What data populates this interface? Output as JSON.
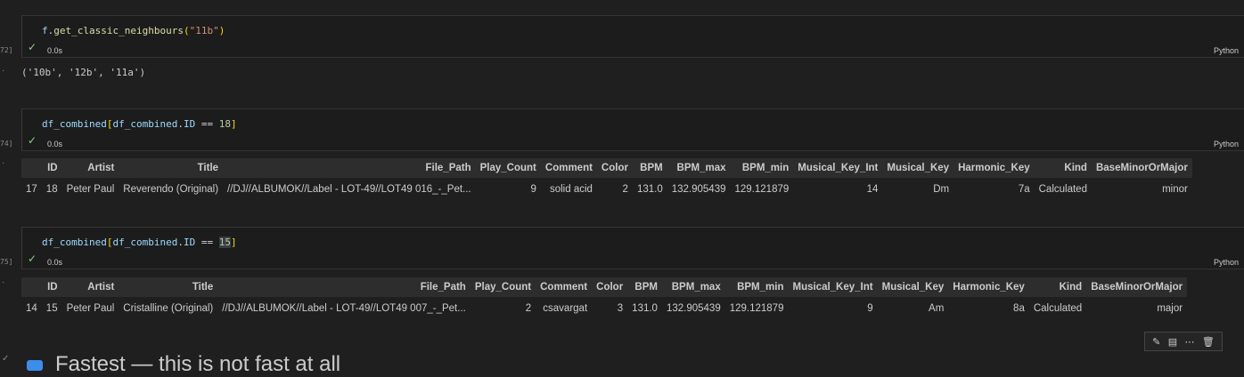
{
  "cells": [
    {
      "exec_label": "72]",
      "code_tokens": [
        {
          "t": "f",
          "c": "t-var"
        },
        {
          "t": ".",
          "c": "t-op"
        },
        {
          "t": "get_classic_neighbours",
          "c": "t-fn"
        },
        {
          "t": "(",
          "c": "t-br"
        },
        {
          "t": "\"11b\"",
          "c": "t-str"
        },
        {
          "t": ")",
          "c": "t-br"
        }
      ],
      "status_icon": "check-icon",
      "time": "0.0s",
      "language": "Python"
    },
    {
      "exec_label": "74]",
      "code_tokens": [
        {
          "t": "df_combined",
          "c": "t-var"
        },
        {
          "t": "[",
          "c": "t-br"
        },
        {
          "t": "df_combined",
          "c": "t-var"
        },
        {
          "t": ".",
          "c": "t-op"
        },
        {
          "t": "ID",
          "c": "t-var"
        },
        {
          "t": " == ",
          "c": "t-op"
        },
        {
          "t": "18",
          "c": "t-num"
        },
        {
          "t": "]",
          "c": "t-br"
        }
      ],
      "status_icon": "check-icon",
      "time": "0.0s",
      "language": "Python"
    },
    {
      "exec_label": "75]",
      "code_tokens": [
        {
          "t": "df_combined",
          "c": "t-var"
        },
        {
          "t": "[",
          "c": "t-br"
        },
        {
          "t": "df_combined",
          "c": "t-var"
        },
        {
          "t": ".",
          "c": "t-op"
        },
        {
          "t": "ID",
          "c": "t-var"
        },
        {
          "t": " == ",
          "c": "t-op"
        },
        {
          "t": "15",
          "c": "t-num t-sel"
        },
        {
          "t": "]",
          "c": "t-br"
        }
      ],
      "status_icon": "check-icon",
      "time": "0.0s",
      "language": "Python"
    }
  ],
  "output_text": "('10b', '12b', '11a')",
  "table_headers": [
    "",
    "ID",
    "Artist",
    "Title",
    "File_Path",
    "Play_Count",
    "Comment",
    "Color",
    "BPM",
    "BPM_max",
    "BPM_min",
    "Musical_Key_Int",
    "Musical_Key",
    "Harmonic_Key",
    "Kind",
    "BaseMinorOrMajor"
  ],
  "table1_row": [
    "17",
    "18",
    "Peter Paul",
    "Reverendo (Original)",
    "//DJ//ALBUMOK//Label - LOT-49//LOT49 016_-_Pet...",
    "9",
    "solid acid",
    "2",
    "131.0",
    "132.905439",
    "129.121879",
    "14",
    "Dm",
    "7a",
    "Calculated",
    "minor"
  ],
  "table2_row": [
    "14",
    "15",
    "Peter Paul",
    "Cristalline (Original)",
    "//DJ//ALBUMOK//Label - LOT-49//LOT49 007_-_Pet...",
    "2",
    "csavargat",
    "3",
    "131.0",
    "132.905439",
    "129.121879",
    "9",
    "Am",
    "8a",
    "Calculated",
    "major"
  ],
  "toolbar_icons": [
    "edit-icon",
    "split-icon",
    "more-icon",
    "delete-icon"
  ],
  "markdown_heading": "Fastest — this is not fast at all"
}
